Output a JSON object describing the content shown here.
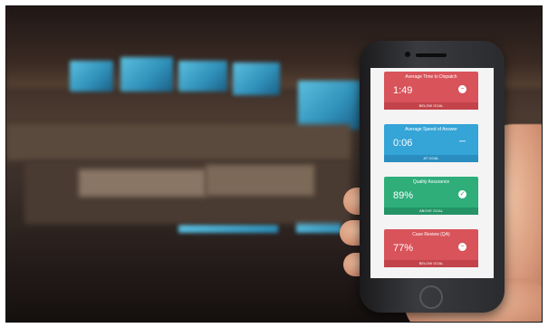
{
  "dashboard": {
    "cards": [
      {
        "title": "Average Time to Dispatch",
        "value": "1:49",
        "status": "BELOW GOAL",
        "icon": "minus-circle-icon"
      },
      {
        "title": "Average Speed of Answer",
        "value": "0:06",
        "status": "AT GOAL",
        "icon": "dash-icon"
      },
      {
        "title": "Quality Assurance",
        "value": "89%",
        "status": "ABOVE GOAL",
        "icon": "check-circle-icon"
      },
      {
        "title": "Case Review (QA)",
        "value": "77%",
        "status": "BELOW GOAL",
        "icon": "minus-circle-icon"
      }
    ]
  },
  "colors": {
    "below_goal": "#d9535a",
    "at_goal": "#35a4d7",
    "above_goal": "#2fae7a"
  }
}
